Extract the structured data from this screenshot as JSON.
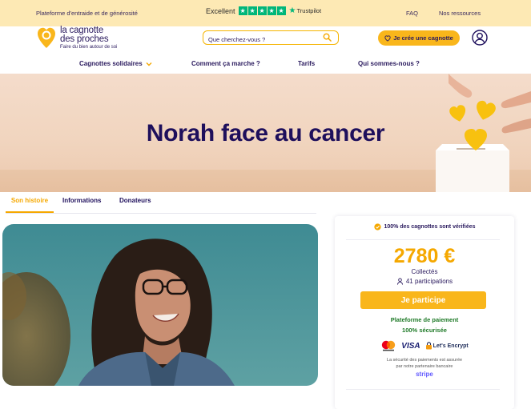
{
  "topbar": {
    "left_text": "Plateforme d'entraide et de générosité",
    "trust_label": "Excellent",
    "trust_brand": "Trustpilot",
    "trust_rating_stars": 5,
    "faq": "FAQ",
    "resources": "Nos ressources"
  },
  "header": {
    "logo_line1": "la cagnotte",
    "logo_line2": "des proches",
    "logo_tagline": "Faire du bien autour de soi",
    "search_placeholder": "Que cherchez-vous ?",
    "create_button": "Je crée une cagnotte"
  },
  "nav": {
    "items": [
      {
        "label": "Cagnottes solidaires",
        "has_dropdown": true
      },
      {
        "label": "Comment ça marche ?"
      },
      {
        "label": "Tarifs"
      },
      {
        "label": "Qui sommes-nous ?"
      }
    ]
  },
  "hero": {
    "title": "Norah face au cancer"
  },
  "tabs": [
    {
      "label": "Son histoire",
      "active": true
    },
    {
      "label": "Informations"
    },
    {
      "label": "Donateurs"
    }
  ],
  "card": {
    "verified_text": "100% des cagnottes sont vérifiées",
    "amount": "2780 €",
    "collected_label": "Collectés",
    "participations": "41 participations",
    "participate_button": "Je participe",
    "secure_line1": "Plateforme de paiement",
    "secure_line2": "100% sécurisée",
    "payment_logos": [
      "mastercard",
      "VISA",
      "Let's Encrypt"
    ],
    "security_note_line1": "La sécurité des paiements est assurée",
    "security_note_line2": "par notre partenaire bancaire",
    "partner": "stripe"
  },
  "colors": {
    "brand_yellow": "#f9b61b",
    "brand_navy": "#1e0f5c",
    "topbar_bg": "#fde9b4",
    "secure_green": "#1f7a28",
    "trustpilot_green": "#00b67a"
  }
}
